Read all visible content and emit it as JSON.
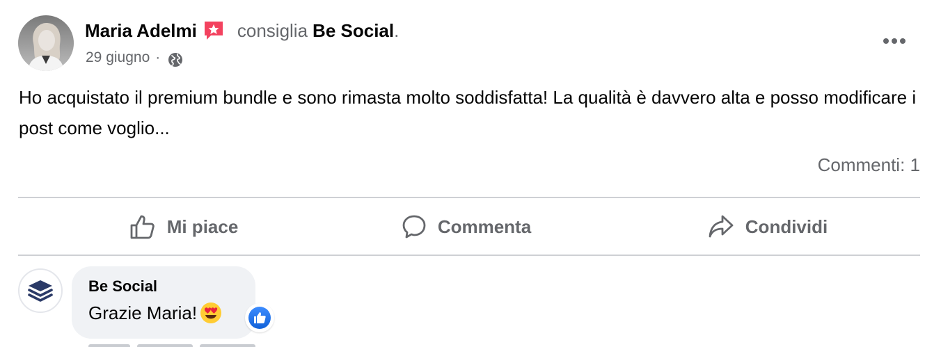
{
  "post": {
    "author": "Maria Adelmi",
    "verb": "consiglia",
    "page_name": "Be Social",
    "trailing_dot": ".",
    "date": "29 giugno",
    "separator": "·",
    "audience_icon": "globe-icon",
    "body": "Ho acquistato il premium bundle e sono rimasta molto soddisfatta! La qualità è davvero alta e posso modificare i post come voglio...",
    "comments_count": "Commenti: 1"
  },
  "actions": [
    {
      "label": "Mi piace",
      "icon": "thumbs-up-icon"
    },
    {
      "label": "Commenta",
      "icon": "comment-icon"
    },
    {
      "label": "Condividi",
      "icon": "share-icon"
    }
  ],
  "comment": {
    "author": "Be Social",
    "text": "Grazie Maria!",
    "emoji": "heart-eyes-emoji",
    "reaction": "like-reaction-icon"
  },
  "colors": {
    "primary_text": "#050505",
    "secondary_text": "#65676b",
    "divider": "#ced0d4",
    "bubble": "#f0f2f5",
    "recommend_badge": "#f3425f",
    "like_blue": "#1877f2",
    "page_logo": "#2b3a67"
  }
}
